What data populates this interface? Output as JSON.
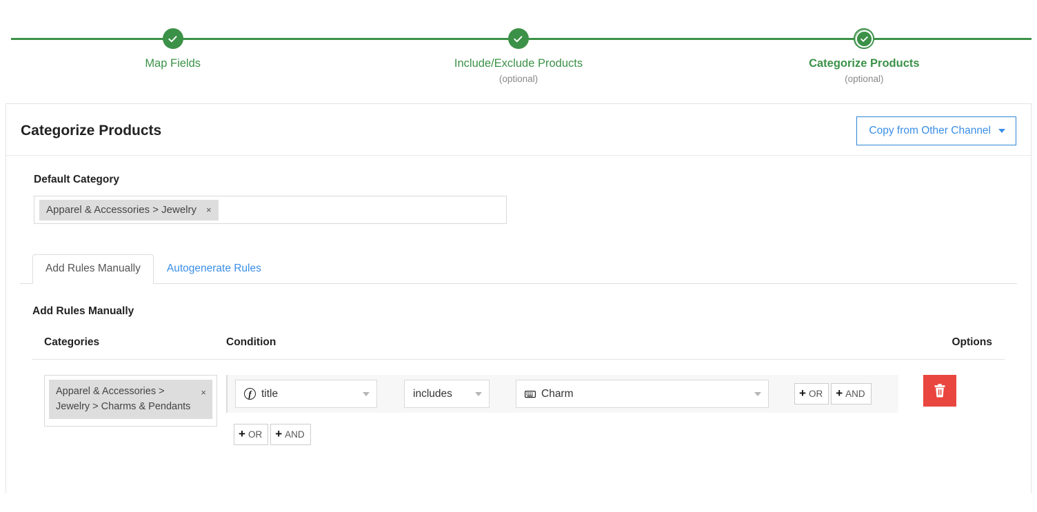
{
  "wizard": {
    "steps": [
      {
        "label": "Map Fields",
        "sub": "",
        "state": "complete"
      },
      {
        "label": "Include/Exclude Products",
        "sub": "(optional)",
        "state": "complete"
      },
      {
        "label": "Categorize Products",
        "sub": "(optional)",
        "state": "current"
      }
    ],
    "accent_color": "#3b9147"
  },
  "card": {
    "title": "Categorize Products",
    "copy_button": "Copy from Other Channel",
    "default_category": {
      "label": "Default Category",
      "token": "Apparel & Accessories > Jewelry",
      "remove": "×"
    },
    "tabs": [
      {
        "label": "Add Rules Manually",
        "active": true
      },
      {
        "label": "Autogenerate Rules",
        "active": false
      }
    ],
    "section_title": "Add Rules Manually",
    "table": {
      "headers": {
        "categories": "Categories",
        "condition": "Condition",
        "options": "Options"
      },
      "rows": [
        {
          "category_token": "Apparel & Accessories > Jewelry > Charms & Pendants",
          "category_remove": "×",
          "condition": {
            "field": "title",
            "field_icon": "function-icon",
            "operator": "includes",
            "value": "Charm",
            "value_icon": "keyboard-icon"
          },
          "inline_buttons": [
            {
              "label": "OR",
              "plus": "+"
            },
            {
              "label": "AND",
              "plus": "+"
            }
          ],
          "row_buttons": [
            {
              "label": "OR",
              "plus": "+"
            },
            {
              "label": "AND",
              "plus": "+"
            }
          ],
          "delete_icon": "trash-icon"
        }
      ]
    }
  },
  "colors": {
    "green": "#3b9147",
    "blue": "#3a8ee6",
    "danger": "#e8463f",
    "token_bg": "#dddddd"
  }
}
